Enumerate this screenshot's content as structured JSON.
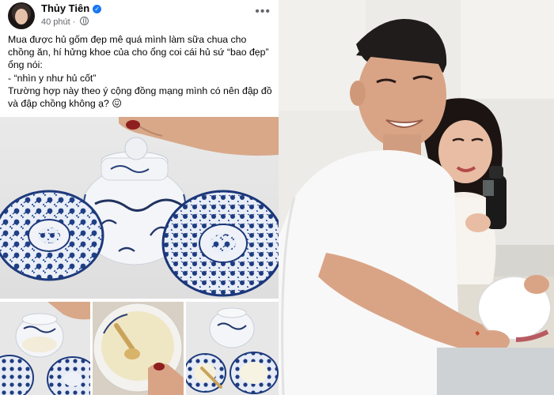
{
  "post": {
    "author": "Thủy Tiên",
    "verified_icon": "verified-badge-icon",
    "time": "40 phút",
    "privacy_icon": "globe-icon",
    "more_label": "•••",
    "text_lines": [
      "Mua được hủ gốm đẹp mê quá mình làm sữa chua cho",
      "chồng ăn, hí hửng khoe của cho ổng coi cái hủ sứ “bao đẹp”",
      "ổng nói:",
      "- “nhìn y như hủ cốt”",
      "Trường hợp này theo ý cộng đồng mạng mình có nên đập đồ",
      "và đập chồng không ạ? 😖"
    ]
  },
  "colors": {
    "facebook_blue": "#1877f2",
    "text_primary": "#050505",
    "text_secondary": "#65676b",
    "porcelain_blue": "#1f3f86"
  }
}
